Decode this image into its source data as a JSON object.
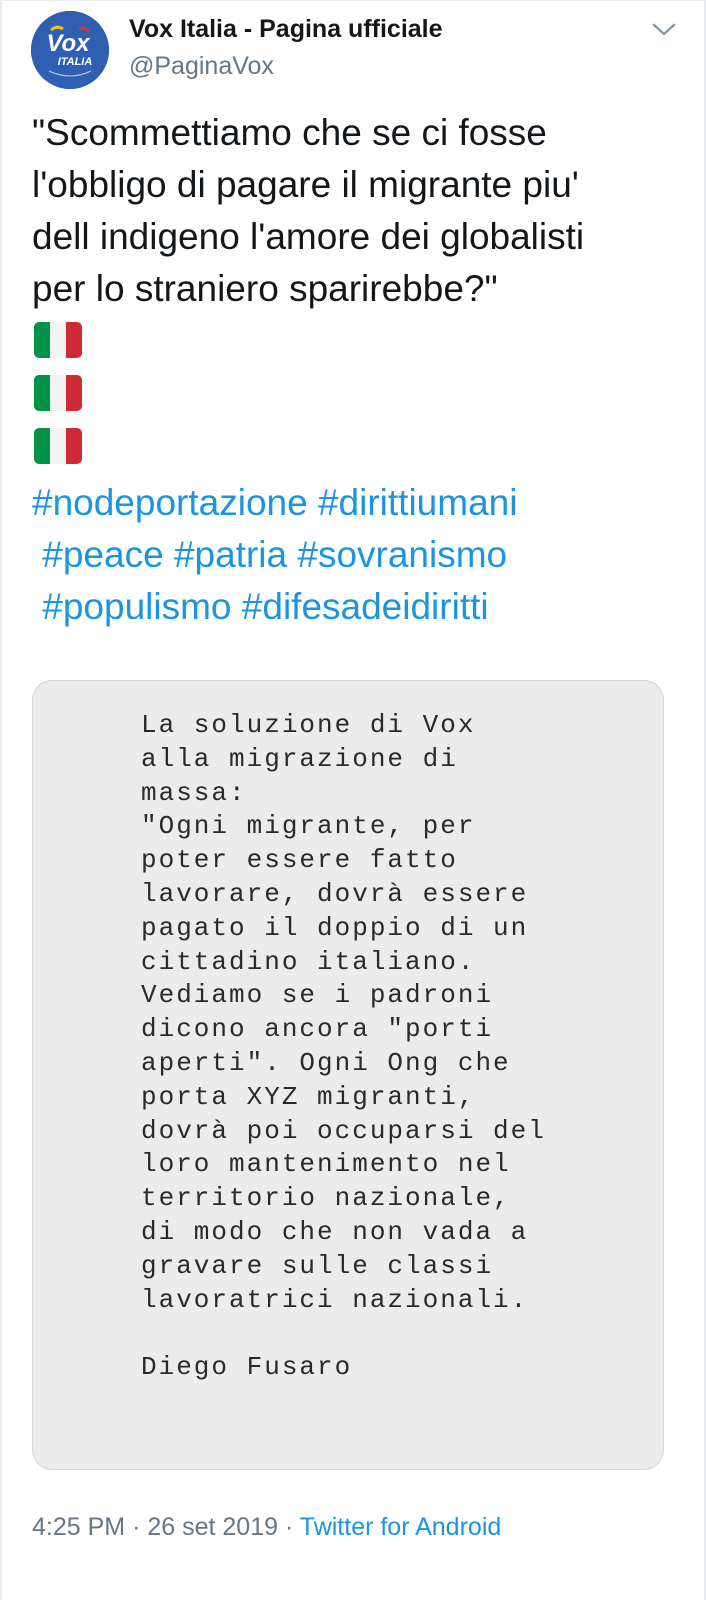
{
  "author": {
    "display_name": "Vox Italia - Pagina ufficiale",
    "handle": "@PaginaVox",
    "avatar_logo_text": "Vox ITALIA"
  },
  "tweet": {
    "text": "\"Scommettiamo che se ci fosse\nl'obbligo di pagare il migrante piu'\ndell indigeno l'amore dei globalisti\nper lo straniero sparirebbe?\"",
    "flags": [
      "italy-flag",
      "italy-flag",
      "italy-flag"
    ],
    "hashtag_lines": [
      [
        "#nodeportazione",
        "#dirittiumani"
      ],
      [
        "#peace",
        "#patria",
        "#sovranismo"
      ],
      [
        "#populismo",
        "#difesadeidiritti"
      ]
    ]
  },
  "media": {
    "quote_lines": [
      "La soluzione di Vox",
      "alla migrazione di",
      "massa:",
      "\"Ogni migrante, per",
      "poter essere fatto",
      "lavorare, dovrà essere",
      "pagato il doppio di un",
      "cittadino italiano.",
      "Vediamo se i padroni",
      "dicono ancora \"porti",
      "aperti\". Ogni Ong che",
      "porta XYZ migranti,",
      "dovrà poi occuparsi del",
      "loro mantenimento nel",
      "territorio nazionale,",
      "di modo che non vada a",
      "gravare sulle classi",
      "lavoratrici nazionali.",
      "",
      "Diego Fusaro"
    ]
  },
  "meta": {
    "time": "4:25 PM",
    "separator": "·",
    "date": "26 set 2019",
    "source": "Twitter for Android"
  },
  "colors": {
    "link": "#1b95e0",
    "secondary_text": "#657786",
    "flag_green": "#009246",
    "flag_white": "#ffffff",
    "flag_red": "#ce2b37",
    "avatar_blue": "#2f5fb3"
  }
}
